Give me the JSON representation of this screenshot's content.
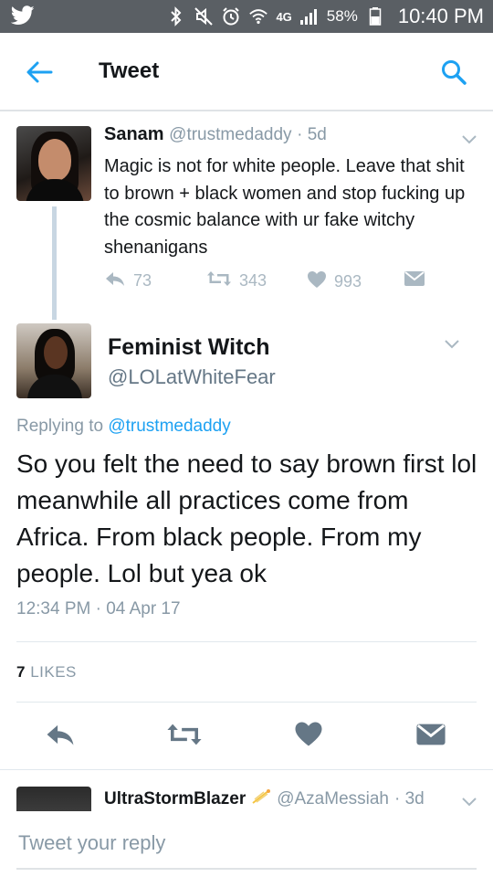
{
  "status_bar": {
    "network": "4G",
    "battery_percent": "58%",
    "time": "10:40 PM"
  },
  "header": {
    "title": "Tweet"
  },
  "parent_tweet": {
    "name": "Sanam",
    "handle": "@trustmedaddy",
    "age": "· 5d",
    "text": "Magic is not for white people. Leave that shit to brown + black women and stop fucking up the cosmic balance with ur fake witchy shenanigans",
    "reply_count": "73",
    "retweet_count": "343",
    "like_count": "993"
  },
  "main_tweet": {
    "name": "Feminist Witch",
    "handle": "@LOLatWhiteFear",
    "replying_prefix": "Replying to",
    "replying_to": "@trustmedaddy",
    "text": "So you felt the need to say brown first lol meanwhile all practices come from Africa. From black people. From my people. Lol but yea ok",
    "timestamp": "12:34 PM · 04 Apr 17",
    "likes_count": "7",
    "likes_label": "LIKES"
  },
  "next_tweet": {
    "name": "UltraStormBlazer",
    "handle": "@AzaMessiah",
    "age": "· 3d"
  },
  "reply_bar": {
    "placeholder": "Tweet your reply"
  },
  "colors": {
    "status_bar": "#5a5f64",
    "twitter_blue": "#1da1f2",
    "muted": "#8899a6",
    "icon_gray": "#aab8c2",
    "action_dark": "#657786"
  }
}
